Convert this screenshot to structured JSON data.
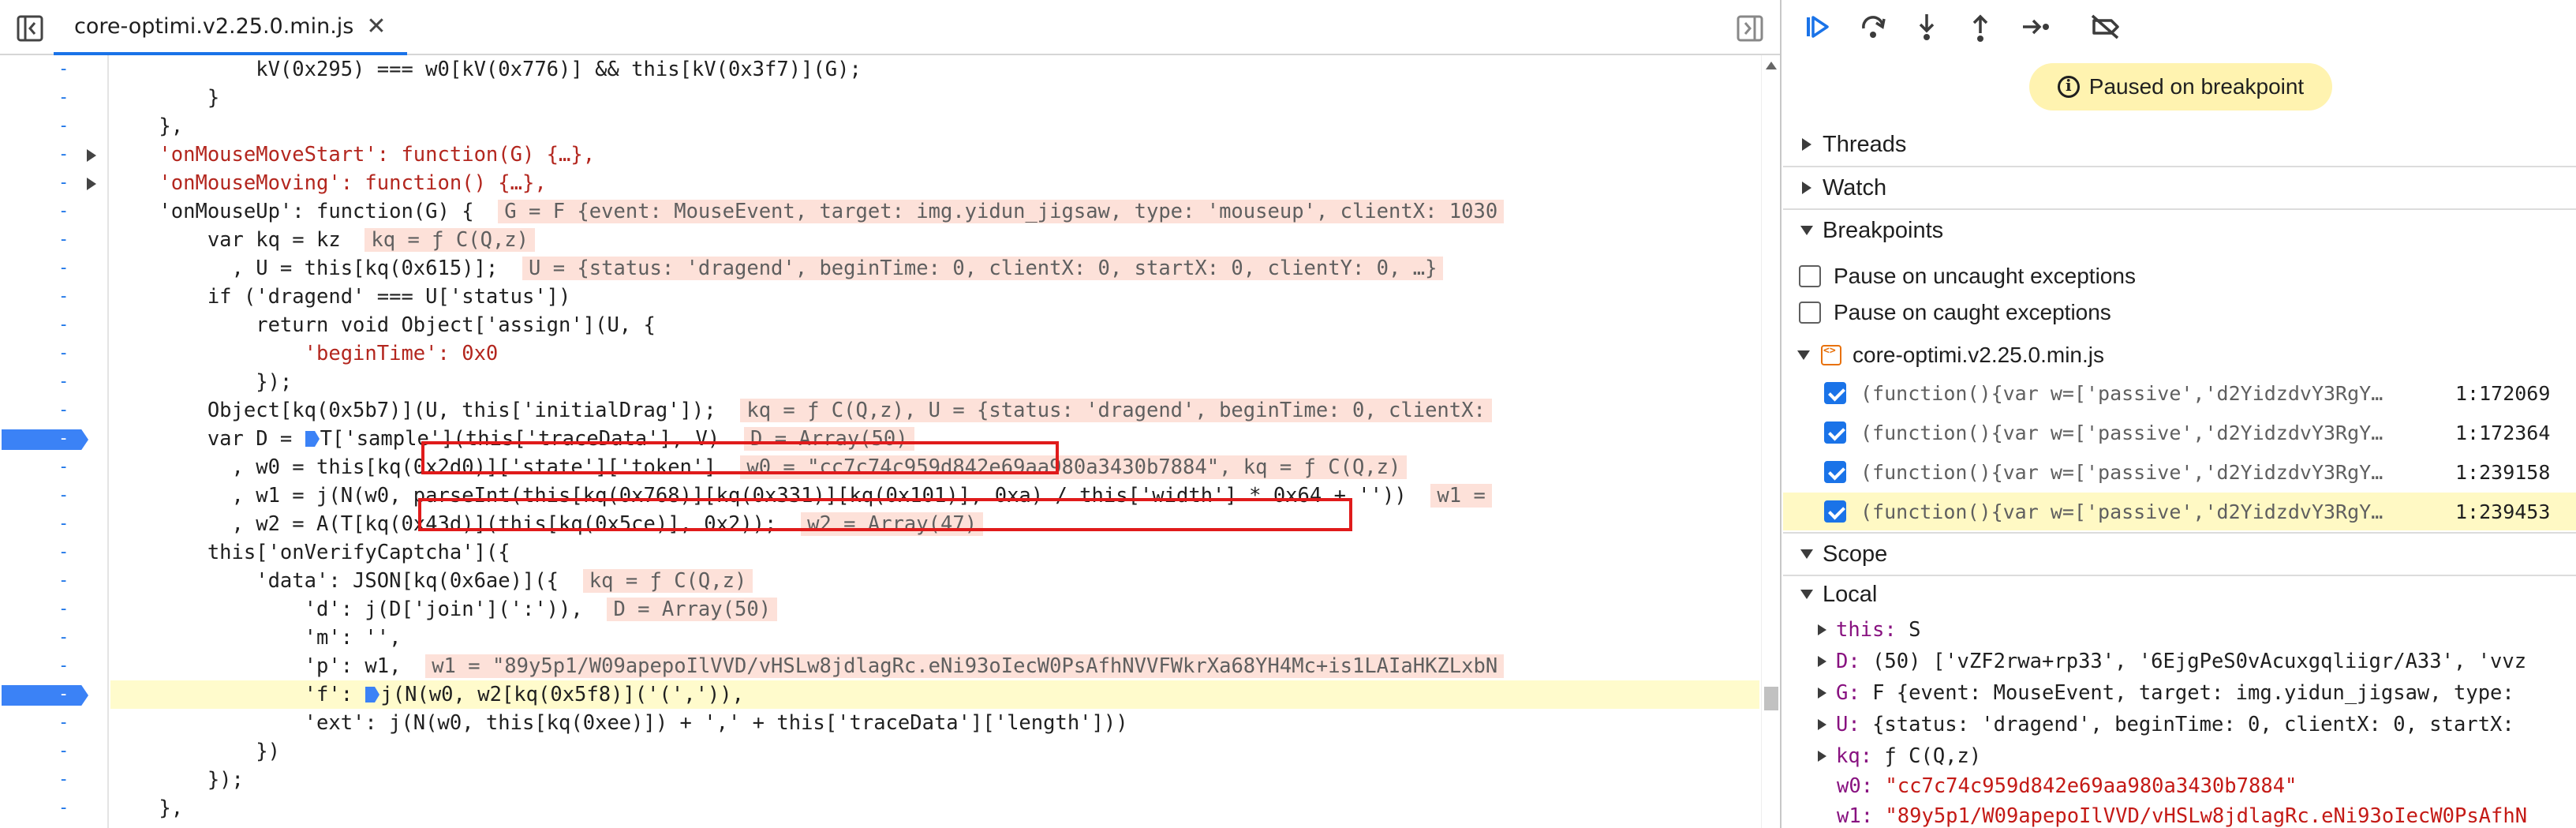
{
  "editor": {
    "tab_filename": "core-optimi.v2.25.0.min.js",
    "tab_close": "✕",
    "lines": [
      "            kV(0x295) === w0[kV(0x776)] && this[kV(0x3f7)](G);",
      "        }",
      "    },",
      "    'onMouseMoveStart': function(G) {…},",
      "    'onMouseMoving': function() {…},",
      "    'onMouseUp': function(G) {",
      "        var kq = kz",
      "          , U = this[kq(0x615)];",
      "        if ('dragend' === U['status'])",
      "            return void Object['assign'](U, {",
      "                'beginTime': 0x0",
      "            });",
      "        Object[kq(0x5b7)](U, this['initialDrag']);",
      "        var D = ",
      "          , w0 = this[kq(0x2d0)]['state']['token']",
      "          , w1 = j(N(w0, parseInt(this[kq(0x768)][kq(0x331)][kq(0x101)], 0xa) / this['width'] * 0x64 + ''))",
      "          , w2 = A(T[kq(0x43d)](this[kq(0x5ce)], 0x2));",
      "        this['onVerifyCaptcha']({",
      "            'data': JSON[kq(0x6ae)]({",
      "                'd': j(D['join'](':')),",
      "                'm': '',",
      "                'p': w1,",
      "                'f': ",
      "                'ext': j(N(w0, this[kq(0xee)]) + ',' + this['traceData']['length']))",
      "            })",
      "        });",
      "    },"
    ],
    "line13_rest": "T['sample'](this['traceData'], V)",
    "line22_rest": "j(N(w0, w2[kq(0x5f8)]('(',')),",
    "inline_values": {
      "l5": "G = F {event: MouseEvent, target: img.yidun_jigsaw, type: 'mouseup', clientX: 1030",
      "l6": "kq = ƒ C(Q,z)",
      "l7": "U = {status: 'dragend', beginTime: 0, clientX: 0, startX: 0, clientY: 0, …}",
      "l12": "kq = ƒ C(Q,z), U = {status: 'dragend', beginTime: 0, clientX:",
      "l13": "D = Array(50)",
      "l14": "w0 = \"cc7c74c959d842e69aa980a3430b7884\", kq = ƒ C(Q,z)",
      "l15": "w1 =",
      "l16": "w2 = Array(47)",
      "l18": "kq = ƒ C(Q,z)",
      "l19": "D = Array(50)",
      "l21": "w1 = \"89y5p1/W09apepoIlVVD/vHSLw8jdlagRc.eNi93oIecW0PsAfhNVVFWkrXa68YH4Mc+is1LAIaHKZLxbN"
    }
  },
  "debugger": {
    "paused_label": "Paused on breakpoint",
    "sections": {
      "threads": "Threads",
      "watch": "Watch",
      "breakpoints": "Breakpoints",
      "scope": "Scope",
      "local": "Local"
    },
    "pause_uncaught": "Pause on uncaught exceptions",
    "pause_caught": "Pause on caught exceptions",
    "bp_file": "core-optimi.v2.25.0.min.js",
    "breakpoints": [
      {
        "code": "(function(){var w=['passive','d2YidzdvY3RgY…",
        "loc": "1:172069",
        "checked": true
      },
      {
        "code": "(function(){var w=['passive','d2YidzdvY3RgY…",
        "loc": "1:172364",
        "checked": true
      },
      {
        "code": "(function(){var w=['passive','d2YidzdvY3RgY…",
        "loc": "1:239158",
        "checked": true
      },
      {
        "code": "(function(){var w=['passive','d2YidzdvY3RgY…",
        "loc": "1:239453",
        "checked": true
      }
    ],
    "scope": {
      "this_key": "this:",
      "this_val": "S",
      "D_key": "D:",
      "D_val": "(50) ['vZF2rwa+rp33', '6EjgPeS0vAcuxgqliigr/A33', 'vvz",
      "G_key": "G:",
      "G_val": "F {event: MouseEvent, target: img.yidun_jigsaw, type:",
      "U_key": "U:",
      "U_val": "{status: 'dragend', beginTime: 0, clientX: 0, startX:",
      "kq_key": "kq:",
      "kq_val": "ƒ C(Q,z)",
      "w0_key": "w0:",
      "w0_val": "\"cc7c74c959d842e69aa980a3430b7884\"",
      "w1_key": "w1:",
      "w1_val": "\"89y5p1/W09apepoIlVVD/vHSLw8jdlagRc.eNi93oIecW0PsAfhN"
    }
  }
}
